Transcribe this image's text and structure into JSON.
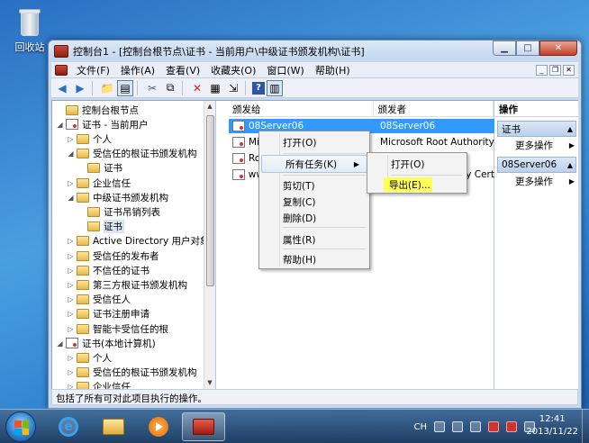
{
  "desktop": {
    "recycle_bin": "回收站"
  },
  "window": {
    "title": "控制台1 - [控制台根节点\\证书 - 当前用户\\中级证书颁发机构\\证书]",
    "menu": [
      "文件(F)",
      "操作(A)",
      "查看(V)",
      "收藏夹(O)",
      "窗口(W)",
      "帮助(H)"
    ],
    "status": "包括了所有可对此项目执行的操作。"
  },
  "tree": [
    {
      "label": "控制台根节点",
      "icon": "folder-icon",
      "level": 0,
      "expander": ""
    },
    {
      "label": "证书 - 当前用户",
      "icon": "cert-store-icon",
      "level": 0,
      "expander": "◢"
    },
    {
      "label": "个人",
      "icon": "folder-icon",
      "level": 1,
      "expander": "▷"
    },
    {
      "label": "受信任的根证书颁发机构",
      "icon": "folder-icon",
      "level": 1,
      "expander": "◢"
    },
    {
      "label": "证书",
      "icon": "folder-icon",
      "level": 2,
      "expander": ""
    },
    {
      "label": "企业信任",
      "icon": "folder-icon",
      "level": 1,
      "expander": "▷"
    },
    {
      "label": "中级证书颁发机构",
      "icon": "folder-icon",
      "level": 1,
      "expander": "◢"
    },
    {
      "label": "证书吊销列表",
      "icon": "folder-icon",
      "level": 2,
      "expander": ""
    },
    {
      "label": "证书",
      "icon": "folder-icon",
      "level": 2,
      "expander": "",
      "selected": true
    },
    {
      "label": "Active Directory 用户对象",
      "icon": "folder-icon",
      "level": 1,
      "expander": "▷"
    },
    {
      "label": "受信任的发布者",
      "icon": "folder-icon",
      "level": 1,
      "expander": "▷"
    },
    {
      "label": "不信任的证书",
      "icon": "folder-icon",
      "level": 1,
      "expander": "▷"
    },
    {
      "label": "第三方根证书颁发机构",
      "icon": "folder-icon",
      "level": 1,
      "expander": "▷"
    },
    {
      "label": "受信任人",
      "icon": "folder-icon",
      "level": 1,
      "expander": "▷"
    },
    {
      "label": "证书注册申请",
      "icon": "folder-icon",
      "level": 1,
      "expander": "▷"
    },
    {
      "label": "智能卡受信任的根",
      "icon": "folder-icon",
      "level": 1,
      "expander": "▷"
    },
    {
      "label": "证书(本地计算机)",
      "icon": "cert-store-icon",
      "level": 0,
      "expander": "◢"
    },
    {
      "label": "个人",
      "icon": "folder-icon",
      "level": 1,
      "expander": "▷"
    },
    {
      "label": "受信任的根证书颁发机构",
      "icon": "folder-icon",
      "level": 1,
      "expander": "▷"
    },
    {
      "label": "企业信任",
      "icon": "folder-icon",
      "level": 1,
      "expander": "▷"
    }
  ],
  "list": {
    "columns": [
      "颁发给",
      "颁发者"
    ],
    "rows": [
      {
        "issued_to": "08Server06",
        "issued_by": "08Server06",
        "selected": true
      },
      {
        "issued_to": "Mic",
        "issued_by": "Microsoft Root Authority"
      },
      {
        "issued_to": "Roo",
        "issued_by": ""
      },
      {
        "issued_to": "ww",
        "issued_by": "y Cert"
      }
    ]
  },
  "context_menu": {
    "items": [
      "打开(O)",
      "所有任务(K)",
      "剪切(T)",
      "复制(C)",
      "删除(D)",
      "属性(R)",
      "帮助(H)"
    ]
  },
  "submenu": {
    "items": [
      "打开(O)",
      "导出(E)..."
    ]
  },
  "actions": {
    "header": "操作",
    "groups": [
      {
        "title": "证书",
        "more": "更多操作"
      },
      {
        "title": "08Server06",
        "more": "更多操作"
      }
    ]
  },
  "taskbar": {
    "ime": "CH",
    "time": "12:41",
    "date": "2013/11/22"
  }
}
